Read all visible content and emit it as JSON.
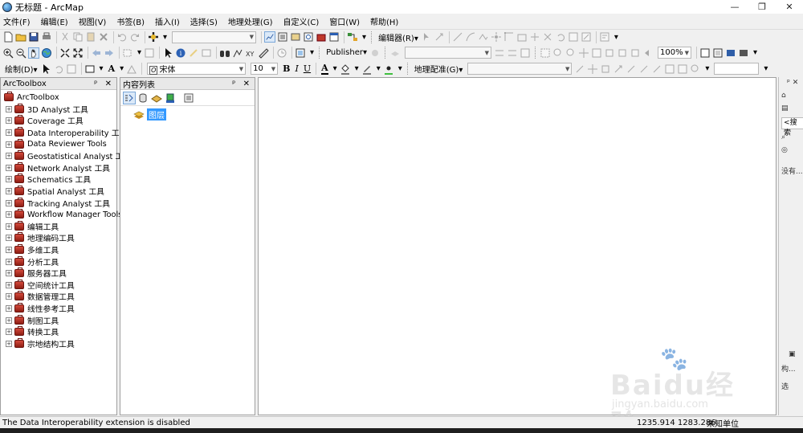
{
  "window": {
    "title": "无标题 - ArcMap",
    "min_glyph": "—",
    "max_glyph": "❐",
    "close_glyph": "✕"
  },
  "menu": [
    "文件(F)",
    "编辑(E)",
    "视图(V)",
    "书签(B)",
    "插入(I)",
    "选择(S)",
    "地理处理(G)",
    "自定义(C)",
    "窗口(W)",
    "帮助(H)"
  ],
  "toolbar": {
    "editor_label": "编辑器(R)▾",
    "publisher_label": "Publisher▾",
    "draw_label": "绘制(D)▾",
    "font_name": "宋体",
    "font_size": "10",
    "bold": "B",
    "italic": "I",
    "underline": "U",
    "georef_label": "地理配准(G)▾",
    "zoom_value": "100%",
    "text_a": "A",
    "font_color_a": "A"
  },
  "arctoolbox": {
    "title": "ArcToolbox",
    "root": "ArcToolbox",
    "items": [
      "3D Analyst 工具",
      "Coverage 工具",
      "Data Interoperability 工具",
      "Data Reviewer Tools",
      "Geostatistical Analyst 工具",
      "Network Analyst 工具",
      "Schematics 工具",
      "Spatial Analyst 工具",
      "Tracking Analyst 工具",
      "Workflow Manager Tools",
      "编辑工具",
      "地理编码工具",
      "多维工具",
      "分析工具",
      "服务器工具",
      "空间统计工具",
      "数据管理工具",
      "线性参考工具",
      "制图工具",
      "转换工具",
      "宗地结构工具"
    ]
  },
  "toc": {
    "title": "内容列表",
    "layer_group": "图层"
  },
  "panel_controls": "ᵖ ✕",
  "right_dock": {
    "search_label": "<搜索",
    "none_label": "没有...",
    "struct_label": "构...",
    "select_label": "选"
  },
  "status": {
    "message": "The Data Interoperability extension is disabled",
    "coordinates": "1235.914  1283.286",
    "units": "未知单位"
  },
  "watermark": {
    "brand": "Baidu经验",
    "url": "jingyan.baidu.com"
  },
  "colors": {
    "selection": "#3399ff",
    "toolbox_icon": "#b3332a"
  }
}
